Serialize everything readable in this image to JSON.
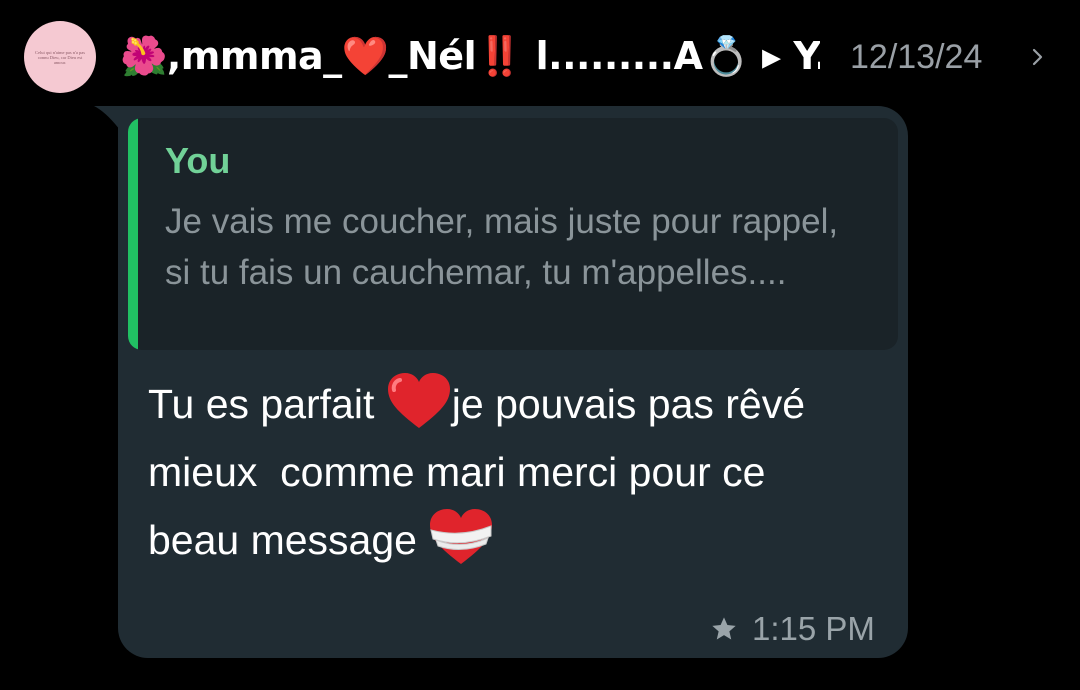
{
  "header": {
    "avatar_text": "Celui qui n'aime pas n'a pas connu Dieu, car Dieu est amour.",
    "sender_name": "🌺,mmma_❤️_Nél‼️ l.........A💍 ▸ Y...",
    "date": "12/13/24",
    "chevron_icon": "chevron-right-icon"
  },
  "message": {
    "quote": {
      "author": "You",
      "text": "Je vais me coucher, mais juste pour rappel, si tu fais un cauchemar, tu m'appelles...."
    },
    "text_part1": "Tu es parfait ",
    "heart1_icon": "red-heart-emoji",
    "text_part2": "je pouvais pas rêvé mieux  comme mari merci pour ce beau message ",
    "heart2_icon": "mending-heart-emoji",
    "star_icon": "star-icon",
    "time": "1:15 PM"
  },
  "colors": {
    "background": "#000000",
    "bubble": "#202c33",
    "quote_background": "#1a2328",
    "quote_bar": "#21c063",
    "quote_author": "#71d197",
    "quote_text": "#8a9499",
    "message_text": "#ffffff",
    "time": "#9aa4a9"
  }
}
